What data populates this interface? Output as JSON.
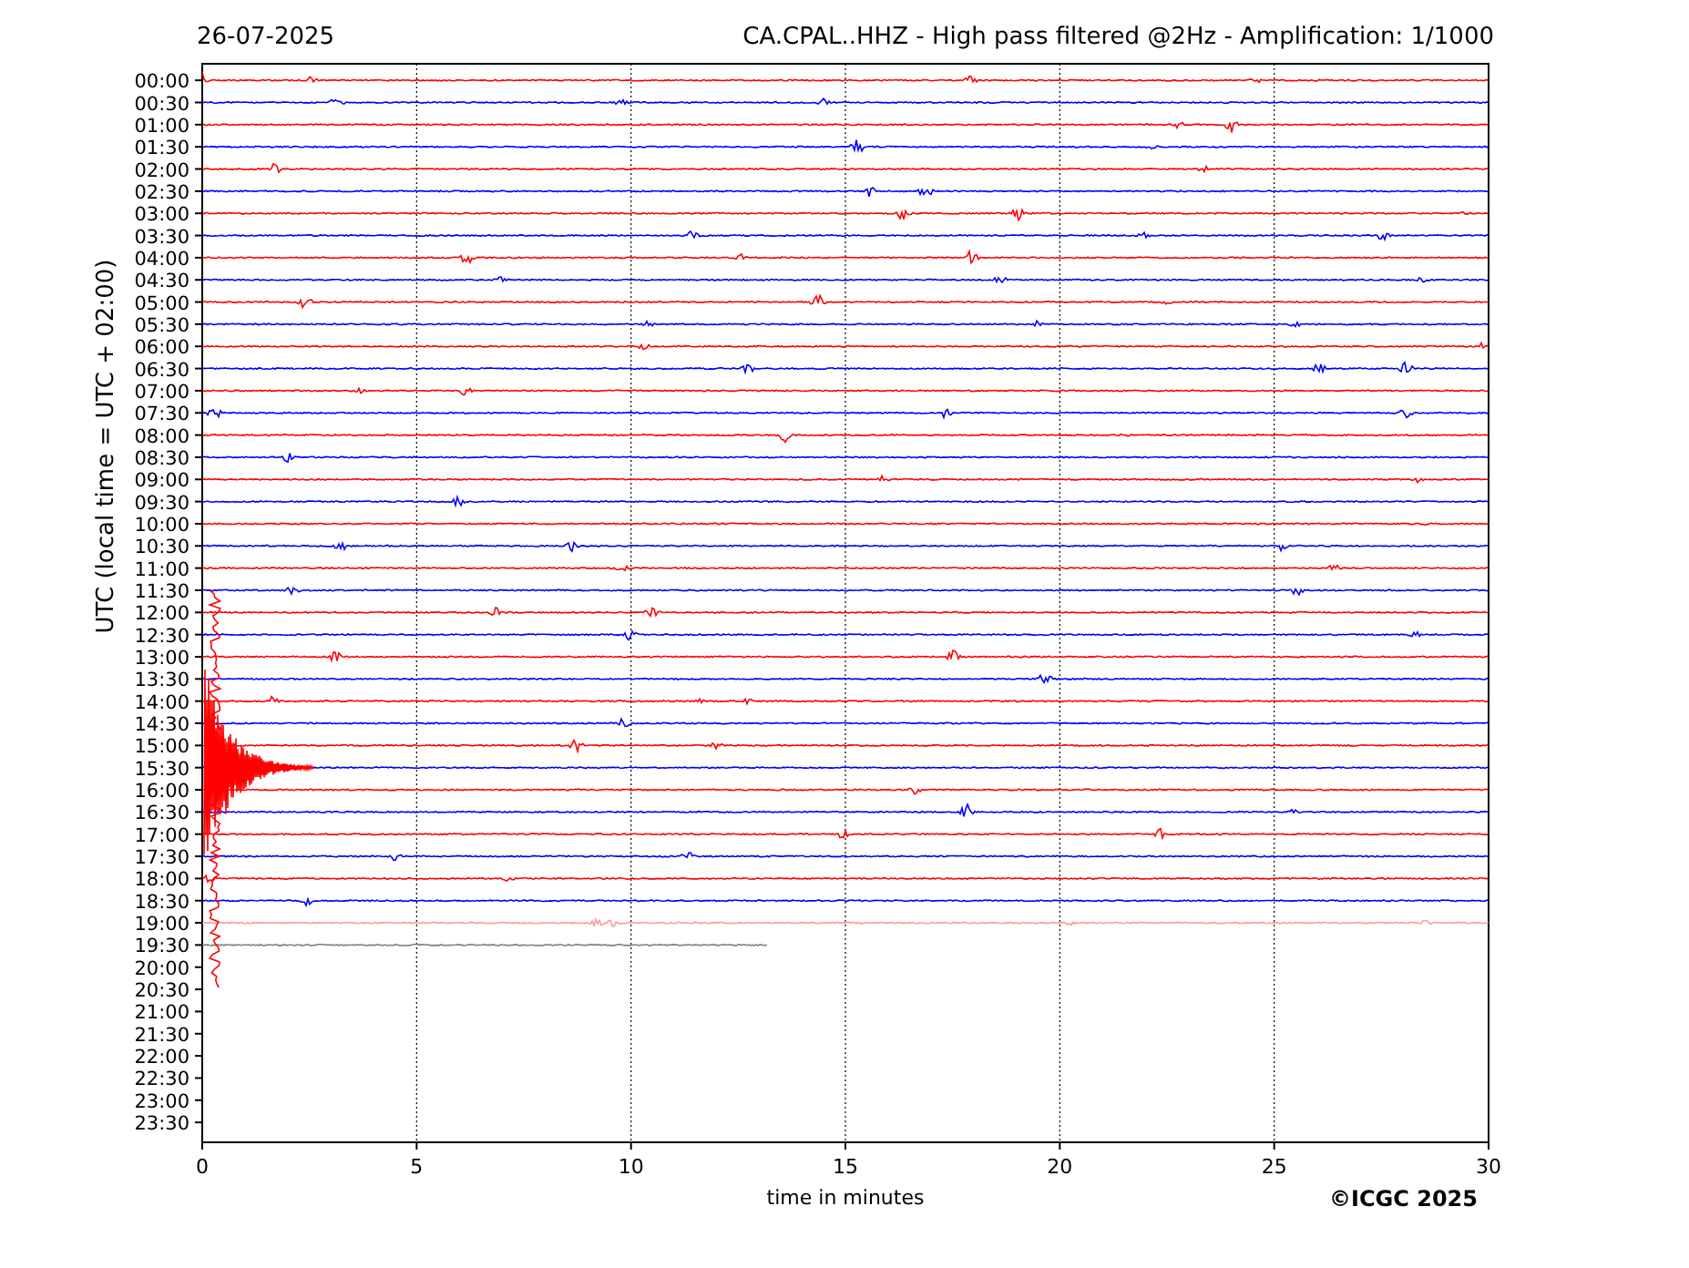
{
  "header": {
    "date": "26-07-2025",
    "title": "CA.CPAL..HHZ - High pass filtered @2Hz - Amplification: 1/1000"
  },
  "plot": {
    "ylabel": "UTC (local time = UTC + 02:00)",
    "xlabel": "time in minutes",
    "xticks": [
      "0",
      "5",
      "10",
      "15",
      "20",
      "25",
      "30"
    ],
    "rows": [
      {
        "label": "00:00",
        "color": "#ff0000",
        "level": 1
      },
      {
        "label": "00:30",
        "color": "#0000ff",
        "level": 1
      },
      {
        "label": "01:00",
        "color": "#ff0000",
        "level": 1
      },
      {
        "label": "01:30",
        "color": "#0000ff",
        "level": 1
      },
      {
        "label": "02:00",
        "color": "#ff0000",
        "level": 1
      },
      {
        "label": "02:30",
        "color": "#0000ff",
        "level": 1
      },
      {
        "label": "03:00",
        "color": "#ff0000",
        "level": 1
      },
      {
        "label": "03:30",
        "color": "#0000ff",
        "level": 1
      },
      {
        "label": "04:00",
        "color": "#ff0000",
        "level": 1
      },
      {
        "label": "04:30",
        "color": "#0000ff",
        "level": 1
      },
      {
        "label": "05:00",
        "color": "#ff0000",
        "level": 1
      },
      {
        "label": "05:30",
        "color": "#0000ff",
        "level": 1
      },
      {
        "label": "06:00",
        "color": "#ff0000",
        "level": 1
      },
      {
        "label": "06:30",
        "color": "#0000ff",
        "level": 1
      },
      {
        "label": "07:00",
        "color": "#ff0000",
        "level": 1
      },
      {
        "label": "07:30",
        "color": "#0000ff",
        "level": 1
      },
      {
        "label": "08:00",
        "color": "#ff0000",
        "level": 1
      },
      {
        "label": "08:30",
        "color": "#0000ff",
        "level": 1
      },
      {
        "label": "09:00",
        "color": "#ff0000",
        "level": 1
      },
      {
        "label": "09:30",
        "color": "#0000ff",
        "level": 1
      },
      {
        "label": "10:00",
        "color": "#ff0000",
        "level": 1
      },
      {
        "label": "10:30",
        "color": "#0000ff",
        "level": 1
      },
      {
        "label": "11:00",
        "color": "#ff0000",
        "level": 1
      },
      {
        "label": "11:30",
        "color": "#0000ff",
        "level": 1
      },
      {
        "label": "12:00",
        "color": "#ff0000",
        "level": 1
      },
      {
        "label": "12:30",
        "color": "#0000ff",
        "level": 1
      },
      {
        "label": "13:00",
        "color": "#ff0000",
        "level": 1
      },
      {
        "label": "13:30",
        "color": "#0000ff",
        "level": 1
      },
      {
        "label": "14:00",
        "color": "#ff0000",
        "level": 1
      },
      {
        "label": "14:30",
        "color": "#0000ff",
        "level": 1
      },
      {
        "label": "15:00",
        "color": "#ff0000",
        "level": 1
      },
      {
        "label": "15:30",
        "color": "#0000ff",
        "level": 1
      },
      {
        "label": "16:00",
        "color": "#ff0000",
        "level": 1
      },
      {
        "label": "16:30",
        "color": "#0000ff",
        "level": 1
      },
      {
        "label": "17:00",
        "color": "#ff0000",
        "level": 1
      },
      {
        "label": "17:30",
        "color": "#0000ff",
        "level": 1
      },
      {
        "label": "18:00",
        "color": "#ff0000",
        "level": 1
      },
      {
        "label": "18:30",
        "color": "#0000ff",
        "level": 1
      },
      {
        "label": "19:00",
        "color": "#ff9999",
        "level": 1
      },
      {
        "label": "19:30",
        "color": "#808080",
        "level": 0.44
      },
      {
        "label": "20:00"
      },
      {
        "label": "20:30"
      },
      {
        "label": "21:00"
      },
      {
        "label": "21:30"
      },
      {
        "label": "22:00"
      },
      {
        "label": "22:30"
      },
      {
        "label": "23:00"
      },
      {
        "label": "23:30"
      }
    ]
  },
  "copyright": "©ICGC 2025"
}
